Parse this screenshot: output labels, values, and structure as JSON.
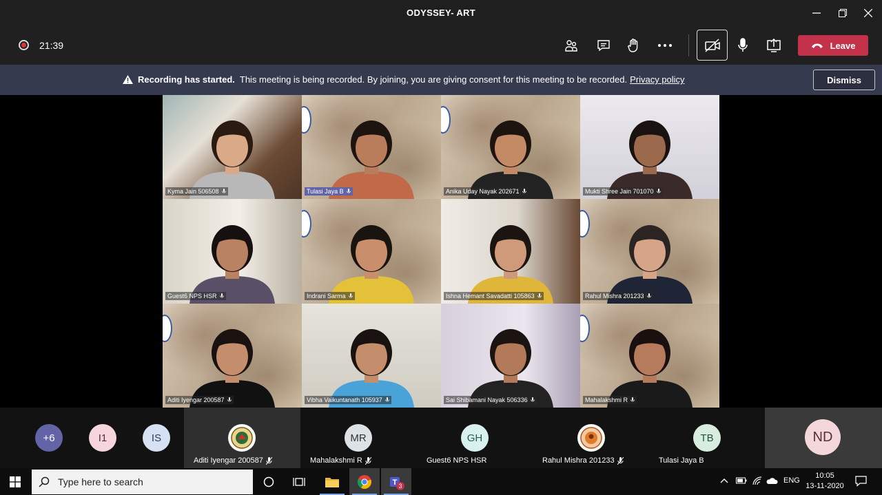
{
  "window": {
    "title": "ODYSSEY- ART"
  },
  "toolbar": {
    "timer": "21:39",
    "leave_label": "Leave"
  },
  "banner": {
    "bold": "Recording has started.",
    "text": "This meeting is being recorded. By joining, you are giving consent for this meeting to be recorded.",
    "link": "Privacy policy",
    "dismiss": "Dismiss"
  },
  "grid": [
    {
      "name": "Kyma Jain 506508",
      "active": false
    },
    {
      "name": "Tulasi Jaya B",
      "active": true
    },
    {
      "name": "Anika Uday Nayak 202671",
      "active": false
    },
    {
      "name": "Mukti Shree Jain 701070",
      "active": false
    },
    {
      "name": "Guest6 NPS HSR",
      "active": false
    },
    {
      "name": "Indrani Sarma",
      "active": false
    },
    {
      "name": "Ishna Hemant Savadatti 105863",
      "active": false
    },
    {
      "name": "Rahul Mishra 201233",
      "active": false
    },
    {
      "name": "Aditi Iyengar 200587",
      "active": false
    },
    {
      "name": "Vibha Vaikuntanath 105937",
      "active": false
    },
    {
      "name": "Sai Shibamani Nayak 506336",
      "active": false
    },
    {
      "name": "Mahalakshmi R",
      "active": false
    }
  ],
  "strip": {
    "more": "+6",
    "initials": [
      "I1",
      "IS"
    ],
    "cells": [
      {
        "name": "Aditi Iyengar 200587",
        "avatar": "emblem"
      },
      {
        "name": "Mahalakshmi R",
        "avatar": "MR"
      },
      {
        "name": "Guest6 NPS HSR",
        "avatar": "GH"
      },
      {
        "name": "Rahul Mishra 201233",
        "avatar": "emblem"
      },
      {
        "name": "Tulasi Jaya B",
        "avatar": "TB"
      }
    ],
    "self": "ND"
  },
  "taskbar": {
    "search_placeholder": "Type here to search",
    "teams_badge": "3",
    "lang": "ENG",
    "time": "10:05",
    "date": "13-11-2020"
  },
  "colors": {
    "leave": "#c4314b",
    "banner": "#363a4f",
    "active_tag": "#6264a7"
  }
}
